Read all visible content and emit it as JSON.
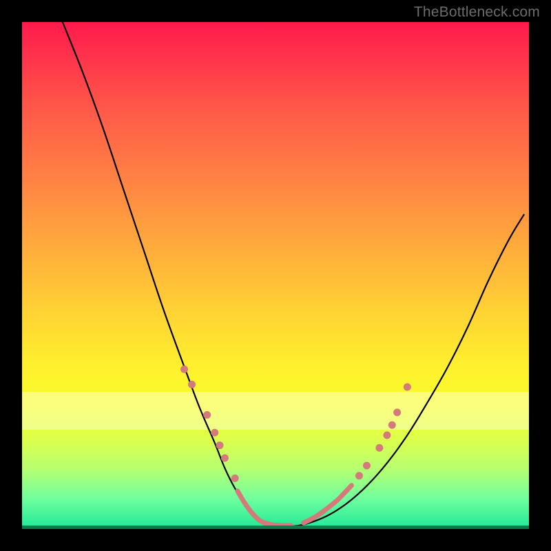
{
  "watermark": "TheBottleneck.com",
  "chart_data": {
    "type": "line",
    "title": "",
    "xlabel": "",
    "ylabel": "",
    "xlim": [
      0,
      100
    ],
    "ylim": [
      0,
      100
    ],
    "grid": false,
    "legend": false,
    "series": [
      {
        "name": "bottleneck-curve",
        "color": "#000000",
        "width": 2.2,
        "x": [
          8,
          12,
          16,
          20,
          24,
          28,
          32,
          35,
          38,
          40,
          42,
          44,
          46,
          48,
          50,
          53,
          56,
          60,
          64,
          68,
          72,
          76,
          80,
          84,
          88,
          92,
          96,
          99
        ],
        "y": [
          100,
          90,
          79,
          67,
          55,
          43,
          32,
          24,
          17,
          12,
          8,
          5,
          2.5,
          1.0,
          0.5,
          0.5,
          1,
          2.5,
          5,
          8.5,
          13,
          18.5,
          25,
          32,
          40,
          49,
          57,
          62
        ]
      },
      {
        "name": "bottom-segment-a",
        "color": "#d47a7b",
        "width": 7,
        "x": [
          42.5,
          44.0,
          45.5,
          47.0,
          49.0,
          51.0,
          53.0
        ],
        "y": [
          7.5,
          5.0,
          3.0,
          1.6,
          0.9,
          0.7,
          0.7
        ]
      },
      {
        "name": "bottom-segment-b",
        "color": "#d47a7b",
        "width": 7,
        "x": [
          55.5,
          57.0,
          58.5,
          60.0,
          62.0,
          63.5,
          65.0
        ],
        "y": [
          1.2,
          1.9,
          2.8,
          3.9,
          5.5,
          7.0,
          8.6
        ]
      }
    ],
    "markers": {
      "left_cluster": {
        "color": "#d47a7b",
        "radius": 5.5,
        "points": [
          {
            "x": 32.0,
            "y": 31.5
          },
          {
            "x": 33.5,
            "y": 28.5
          },
          {
            "x": 36.5,
            "y": 22.5
          },
          {
            "x": 38.0,
            "y": 19.0
          },
          {
            "x": 39.0,
            "y": 16.5
          },
          {
            "x": 40.0,
            "y": 14.0
          },
          {
            "x": 42.0,
            "y": 10.0
          }
        ]
      },
      "right_cluster": {
        "color": "#d47a7b",
        "radius": 5.5,
        "points": [
          {
            "x": 66.5,
            "y": 10.5
          },
          {
            "x": 68.0,
            "y": 12.5
          },
          {
            "x": 70.5,
            "y": 16.0
          },
          {
            "x": 72.0,
            "y": 18.5
          },
          {
            "x": 73.0,
            "y": 20.5
          },
          {
            "x": 74.0,
            "y": 23.0
          },
          {
            "x": 76.0,
            "y": 28.0
          }
        ]
      }
    },
    "light_band": {
      "y_start": 19.5,
      "height": 7.5
    }
  }
}
